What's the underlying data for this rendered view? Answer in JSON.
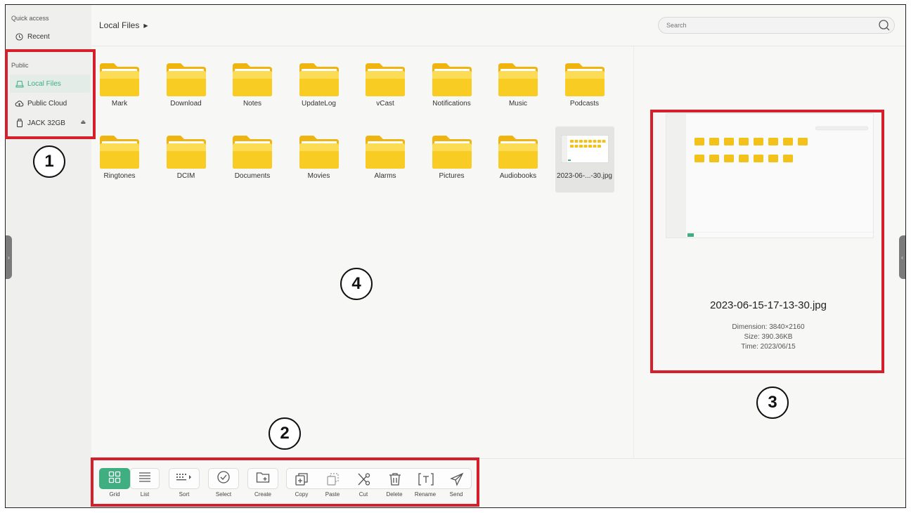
{
  "sidebar": {
    "quick_access_label": "Quick access",
    "recent_label": "Recent",
    "public_label": "Public",
    "items": [
      {
        "label": "Local Files",
        "icon": "local-files-icon"
      },
      {
        "label": "Public Cloud",
        "icon": "cloud-icon"
      },
      {
        "label": "JACK 32GB",
        "icon": "usb-drive-icon"
      }
    ]
  },
  "header": {
    "breadcrumb": "Local Files",
    "search_placeholder": "Search"
  },
  "files": [
    {
      "name": "Mark",
      "type": "folder"
    },
    {
      "name": "Download",
      "type": "folder"
    },
    {
      "name": "Notes",
      "type": "folder"
    },
    {
      "name": "UpdateLog",
      "type": "folder"
    },
    {
      "name": "vCast",
      "type": "folder"
    },
    {
      "name": "Notifications",
      "type": "folder"
    },
    {
      "name": "Music",
      "type": "folder"
    },
    {
      "name": "Podcasts",
      "type": "folder"
    },
    {
      "name": "Ringtones",
      "type": "folder"
    },
    {
      "name": "DCIM",
      "type": "folder"
    },
    {
      "name": "Documents",
      "type": "folder"
    },
    {
      "name": "Movies",
      "type": "folder"
    },
    {
      "name": "Alarms",
      "type": "folder"
    },
    {
      "name": "Pictures",
      "type": "folder"
    },
    {
      "name": "Audiobooks",
      "type": "folder"
    },
    {
      "name": "2023-06-...-30.jpg",
      "type": "image",
      "selected": true
    }
  ],
  "preview": {
    "filename": "2023-06-15-17-13-30.jpg",
    "dimension": "Dimension: 3840×2160",
    "size": "Size: 390.36KB",
    "time": "Time: 2023/06/15"
  },
  "toolbar": {
    "grid": "Grid",
    "list": "List",
    "sort": "Sort",
    "select": "Select",
    "create": "Create",
    "copy": "Copy",
    "paste": "Paste",
    "cut": "Cut",
    "delete": "Delete",
    "rename": "Rename",
    "send": "Send"
  },
  "callouts": {
    "one": "1",
    "two": "2",
    "three": "3",
    "four": "4"
  },
  "colors": {
    "accent": "#3fae81",
    "highlight": "#d61f2c",
    "folder": "#f5c518"
  }
}
